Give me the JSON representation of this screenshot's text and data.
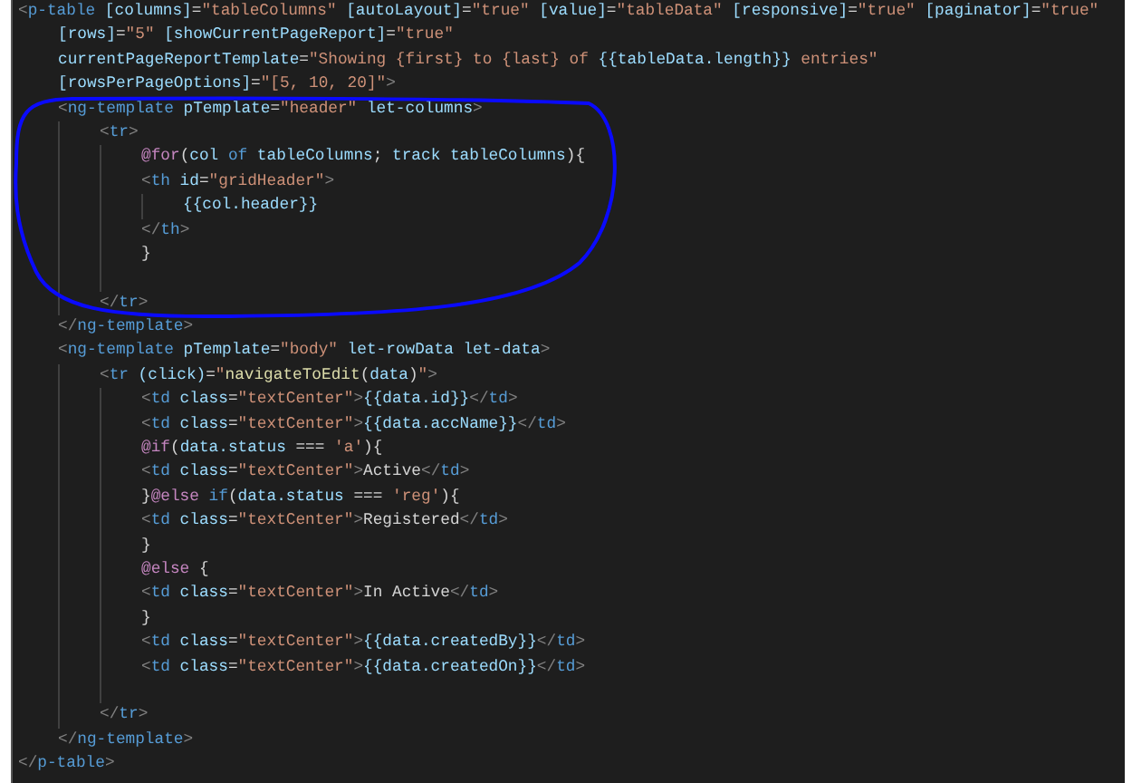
{
  "editor": {
    "lines": [
      {
        "kind": "code",
        "tokens": [
          {
            "kind": "punct",
            "text": "<"
          },
          {
            "kind": "tag",
            "text": "p-table"
          },
          {
            "kind": "attr",
            "text": " [columns]"
          },
          {
            "kind": "text",
            "text": "="
          },
          {
            "kind": "str",
            "text": "\"tableColumns\""
          },
          {
            "kind": "attr",
            "text": " [autoLayout]"
          },
          {
            "kind": "text",
            "text": "="
          },
          {
            "kind": "str",
            "text": "\"true\""
          },
          {
            "kind": "attr",
            "text": " [value]"
          },
          {
            "kind": "text",
            "text": "="
          },
          {
            "kind": "str",
            "text": "\"tableData\""
          },
          {
            "kind": "attr",
            "text": " [responsive]"
          },
          {
            "kind": "text",
            "text": "="
          },
          {
            "kind": "str",
            "text": "\"true\""
          },
          {
            "kind": "attr",
            "text": " [paginator]"
          },
          {
            "kind": "text",
            "text": "="
          },
          {
            "kind": "str",
            "text": "\"true\""
          }
        ],
        "children": [
          {
            "kind": "code",
            "tokens": [
              {
                "kind": "attr",
                "text": "[rows]"
              },
              {
                "kind": "text",
                "text": "="
              },
              {
                "kind": "str",
                "text": "\"5\""
              },
              {
                "kind": "attr",
                "text": " [showCurrentPageReport]"
              },
              {
                "kind": "text",
                "text": "="
              },
              {
                "kind": "str",
                "text": "\"true\""
              }
            ]
          },
          {
            "kind": "code",
            "tokens": [
              {
                "kind": "attr",
                "text": "currentPageReportTemplate"
              },
              {
                "kind": "text",
                "text": "="
              },
              {
                "kind": "str",
                "text": "\"Showing {first} to {last} of "
              },
              {
                "kind": "var",
                "text": "{{tableData.length}}"
              },
              {
                "kind": "str",
                "text": " entries\""
              }
            ]
          },
          {
            "kind": "code",
            "tokens": [
              {
                "kind": "attr",
                "text": "[rowsPerPageOptions]"
              },
              {
                "kind": "text",
                "text": "="
              },
              {
                "kind": "str",
                "text": "\"[5, 10, 20]\""
              },
              {
                "kind": "punct",
                "text": ">"
              }
            ]
          },
          {
            "kind": "code",
            "tokens": [
              {
                "kind": "punct",
                "text": "<"
              },
              {
                "kind": "tag",
                "text": "ng-template"
              },
              {
                "kind": "attr",
                "text": " pTemplate"
              },
              {
                "kind": "text",
                "text": "="
              },
              {
                "kind": "str",
                "text": "\"header\""
              },
              {
                "kind": "attr",
                "text": " let-columns"
              },
              {
                "kind": "punct",
                "text": ">"
              }
            ],
            "children": [
              {
                "kind": "code",
                "tokens": [
                  {
                    "kind": "punct",
                    "text": "<"
                  },
                  {
                    "kind": "tag",
                    "text": "tr"
                  },
                  {
                    "kind": "punct",
                    "text": ">"
                  }
                ],
                "children": [
                  {
                    "kind": "code",
                    "tokens": [
                      {
                        "kind": "ctrl",
                        "text": "@for"
                      },
                      {
                        "kind": "text",
                        "text": "("
                      },
                      {
                        "kind": "var",
                        "text": "col"
                      },
                      {
                        "kind": "kw",
                        "text": " of"
                      },
                      {
                        "kind": "var",
                        "text": " tableColumns"
                      },
                      {
                        "kind": "text",
                        "text": "; "
                      },
                      {
                        "kind": "var",
                        "text": "track tableColumns"
                      },
                      {
                        "kind": "text",
                        "text": "){"
                      }
                    ]
                  },
                  {
                    "kind": "code",
                    "tokens": [
                      {
                        "kind": "punct",
                        "text": "<"
                      },
                      {
                        "kind": "tag",
                        "text": "th"
                      },
                      {
                        "kind": "attr",
                        "text": " id"
                      },
                      {
                        "kind": "text",
                        "text": "="
                      },
                      {
                        "kind": "str",
                        "text": "\"gridHeader\""
                      },
                      {
                        "kind": "punct",
                        "text": ">"
                      }
                    ],
                    "children": [
                      {
                        "kind": "code",
                        "tokens": [
                          {
                            "kind": "var",
                            "text": "{{col.header}}"
                          }
                        ]
                      }
                    ]
                  },
                  {
                    "kind": "code",
                    "tokens": [
                      {
                        "kind": "punct",
                        "text": "</"
                      },
                      {
                        "kind": "tag",
                        "text": "th"
                      },
                      {
                        "kind": "punct",
                        "text": ">"
                      }
                    ]
                  },
                  {
                    "kind": "code",
                    "tokens": [
                      {
                        "kind": "text",
                        "text": "}"
                      }
                    ]
                  },
                  {
                    "kind": "blank"
                  }
                ]
              },
              {
                "kind": "code",
                "tokens": [
                  {
                    "kind": "punct",
                    "text": "</"
                  },
                  {
                    "kind": "tag",
                    "text": "tr"
                  },
                  {
                    "kind": "punct",
                    "text": ">"
                  }
                ]
              }
            ]
          },
          {
            "kind": "code",
            "tokens": [
              {
                "kind": "punct",
                "text": "</"
              },
              {
                "kind": "tag",
                "text": "ng-template"
              },
              {
                "kind": "punct",
                "text": ">"
              }
            ]
          },
          {
            "kind": "code",
            "tokens": [
              {
                "kind": "punct",
                "text": "<"
              },
              {
                "kind": "tag",
                "text": "ng-template"
              },
              {
                "kind": "attr",
                "text": " pTemplate"
              },
              {
                "kind": "text",
                "text": "="
              },
              {
                "kind": "str",
                "text": "\"body\""
              },
              {
                "kind": "attr",
                "text": " let-rowData let-data"
              },
              {
                "kind": "punct",
                "text": ">"
              }
            ],
            "children": [
              {
                "kind": "code",
                "tokens": [
                  {
                    "kind": "punct",
                    "text": "<"
                  },
                  {
                    "kind": "tag",
                    "text": "tr"
                  },
                  {
                    "kind": "attr",
                    "text": " (click)"
                  },
                  {
                    "kind": "text",
                    "text": "="
                  },
                  {
                    "kind": "str",
                    "text": "\""
                  },
                  {
                    "kind": "func",
                    "text": "navigateToEdit"
                  },
                  {
                    "kind": "text",
                    "text": "("
                  },
                  {
                    "kind": "var",
                    "text": "data"
                  },
                  {
                    "kind": "text",
                    "text": ")"
                  },
                  {
                    "kind": "str",
                    "text": "\""
                  },
                  {
                    "kind": "punct",
                    "text": ">"
                  }
                ],
                "children": [
                  {
                    "kind": "code",
                    "tokens": [
                      {
                        "kind": "punct",
                        "text": "<"
                      },
                      {
                        "kind": "tag",
                        "text": "td"
                      },
                      {
                        "kind": "attr",
                        "text": " class"
                      },
                      {
                        "kind": "text",
                        "text": "="
                      },
                      {
                        "kind": "str",
                        "text": "\"textCenter\""
                      },
                      {
                        "kind": "punct",
                        "text": ">"
                      },
                      {
                        "kind": "var",
                        "text": "{{data.id}}"
                      },
                      {
                        "kind": "punct",
                        "text": "</"
                      },
                      {
                        "kind": "tag",
                        "text": "td"
                      },
                      {
                        "kind": "punct",
                        "text": ">"
                      }
                    ]
                  },
                  {
                    "kind": "code",
                    "tokens": [
                      {
                        "kind": "punct",
                        "text": "<"
                      },
                      {
                        "kind": "tag",
                        "text": "td"
                      },
                      {
                        "kind": "attr",
                        "text": " class"
                      },
                      {
                        "kind": "text",
                        "text": "="
                      },
                      {
                        "kind": "str",
                        "text": "\"textCenter\""
                      },
                      {
                        "kind": "punct",
                        "text": ">"
                      },
                      {
                        "kind": "var",
                        "text": "{{data.accName}}"
                      },
                      {
                        "kind": "punct",
                        "text": "</"
                      },
                      {
                        "kind": "tag",
                        "text": "td"
                      },
                      {
                        "kind": "punct",
                        "text": ">"
                      }
                    ]
                  },
                  {
                    "kind": "code",
                    "tokens": [
                      {
                        "kind": "ctrl",
                        "text": "@if"
                      },
                      {
                        "kind": "text",
                        "text": "("
                      },
                      {
                        "kind": "var",
                        "text": "data.status"
                      },
                      {
                        "kind": "text",
                        "text": " === "
                      },
                      {
                        "kind": "str",
                        "text": "'a'"
                      },
                      {
                        "kind": "text",
                        "text": "){"
                      }
                    ]
                  },
                  {
                    "kind": "code",
                    "tokens": [
                      {
                        "kind": "punct",
                        "text": "<"
                      },
                      {
                        "kind": "tag",
                        "text": "td"
                      },
                      {
                        "kind": "attr",
                        "text": " class"
                      },
                      {
                        "kind": "text",
                        "text": "="
                      },
                      {
                        "kind": "str",
                        "text": "\"textCenter\""
                      },
                      {
                        "kind": "punct",
                        "text": ">"
                      },
                      {
                        "kind": "text",
                        "text": "Active"
                      },
                      {
                        "kind": "punct",
                        "text": "</"
                      },
                      {
                        "kind": "tag",
                        "text": "td"
                      },
                      {
                        "kind": "punct",
                        "text": ">"
                      }
                    ]
                  },
                  {
                    "kind": "code",
                    "tokens": [
                      {
                        "kind": "text",
                        "text": "}"
                      },
                      {
                        "kind": "ctrl",
                        "text": "@else"
                      },
                      {
                        "kind": "kw",
                        "text": " if"
                      },
                      {
                        "kind": "text",
                        "text": "("
                      },
                      {
                        "kind": "var",
                        "text": "data.status"
                      },
                      {
                        "kind": "text",
                        "text": " === "
                      },
                      {
                        "kind": "str",
                        "text": "'reg'"
                      },
                      {
                        "kind": "text",
                        "text": "){"
                      }
                    ]
                  },
                  {
                    "kind": "code",
                    "tokens": [
                      {
                        "kind": "punct",
                        "text": "<"
                      },
                      {
                        "kind": "tag",
                        "text": "td"
                      },
                      {
                        "kind": "attr",
                        "text": " class"
                      },
                      {
                        "kind": "text",
                        "text": "="
                      },
                      {
                        "kind": "str",
                        "text": "\"textCenter\""
                      },
                      {
                        "kind": "punct",
                        "text": ">"
                      },
                      {
                        "kind": "text",
                        "text": "Registered"
                      },
                      {
                        "kind": "punct",
                        "text": "</"
                      },
                      {
                        "kind": "tag",
                        "text": "td"
                      },
                      {
                        "kind": "punct",
                        "text": ">"
                      }
                    ]
                  },
                  {
                    "kind": "code",
                    "tokens": [
                      {
                        "kind": "text",
                        "text": "}"
                      }
                    ]
                  },
                  {
                    "kind": "code",
                    "tokens": [
                      {
                        "kind": "ctrl",
                        "text": "@else"
                      },
                      {
                        "kind": "text",
                        "text": " {"
                      }
                    ]
                  },
                  {
                    "kind": "code",
                    "tokens": [
                      {
                        "kind": "punct",
                        "text": "<"
                      },
                      {
                        "kind": "tag",
                        "text": "td"
                      },
                      {
                        "kind": "attr",
                        "text": " class"
                      },
                      {
                        "kind": "text",
                        "text": "="
                      },
                      {
                        "kind": "str",
                        "text": "\"textCenter\""
                      },
                      {
                        "kind": "punct",
                        "text": ">"
                      },
                      {
                        "kind": "text",
                        "text": "In Active"
                      },
                      {
                        "kind": "punct",
                        "text": "</"
                      },
                      {
                        "kind": "tag",
                        "text": "td"
                      },
                      {
                        "kind": "punct",
                        "text": ">"
                      }
                    ]
                  },
                  {
                    "kind": "code",
                    "tokens": [
                      {
                        "kind": "text",
                        "text": "}"
                      }
                    ]
                  },
                  {
                    "kind": "code",
                    "tokens": [
                      {
                        "kind": "punct",
                        "text": "<"
                      },
                      {
                        "kind": "tag",
                        "text": "td"
                      },
                      {
                        "kind": "attr",
                        "text": " class"
                      },
                      {
                        "kind": "text",
                        "text": "="
                      },
                      {
                        "kind": "str",
                        "text": "\"textCenter\""
                      },
                      {
                        "kind": "punct",
                        "text": ">"
                      },
                      {
                        "kind": "var",
                        "text": "{{data.createdBy}}"
                      },
                      {
                        "kind": "punct",
                        "text": "</"
                      },
                      {
                        "kind": "tag",
                        "text": "td"
                      },
                      {
                        "kind": "punct",
                        "text": ">"
                      }
                    ]
                  },
                  {
                    "kind": "code",
                    "tokens": [
                      {
                        "kind": "punct",
                        "text": "<"
                      },
                      {
                        "kind": "tag",
                        "text": "td"
                      },
                      {
                        "kind": "attr",
                        "text": " class"
                      },
                      {
                        "kind": "text",
                        "text": "="
                      },
                      {
                        "kind": "str",
                        "text": "\"textCenter\""
                      },
                      {
                        "kind": "punct",
                        "text": ">"
                      },
                      {
                        "kind": "var",
                        "text": "{{data.createdOn}}"
                      },
                      {
                        "kind": "punct",
                        "text": "</"
                      },
                      {
                        "kind": "tag",
                        "text": "td"
                      },
                      {
                        "kind": "punct",
                        "text": ">"
                      }
                    ]
                  },
                  {
                    "kind": "blank"
                  }
                ]
              },
              {
                "kind": "code",
                "tokens": [
                  {
                    "kind": "punct",
                    "text": "</"
                  },
                  {
                    "kind": "tag",
                    "text": "tr"
                  },
                  {
                    "kind": "punct",
                    "text": ">"
                  }
                ]
              }
            ]
          },
          {
            "kind": "code",
            "tokens": [
              {
                "kind": "punct",
                "text": "</"
              },
              {
                "kind": "tag",
                "text": "ng-template"
              },
              {
                "kind": "punct",
                "text": ">"
              }
            ]
          }
        ]
      },
      {
        "kind": "code",
        "tokens": [
          {
            "kind": "punct",
            "text": "</"
          },
          {
            "kind": "tag",
            "text": "p-table"
          },
          {
            "kind": "punct",
            "text": ">"
          }
        ]
      }
    ]
  }
}
